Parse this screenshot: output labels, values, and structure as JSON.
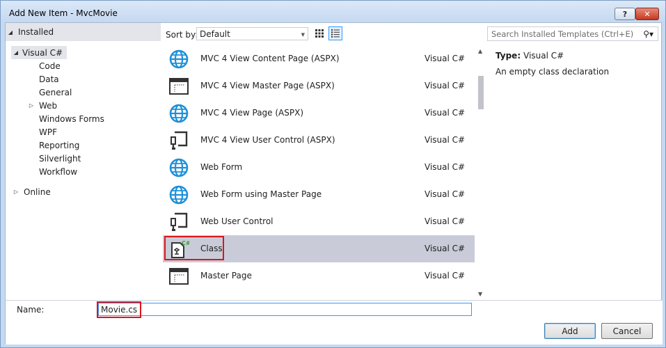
{
  "window": {
    "title": "Add New Item - MvcMovie",
    "help_label": "?",
    "close_label": "✕"
  },
  "tree": {
    "header": "Installed",
    "nodes": [
      {
        "label": "Visual C#",
        "expander": "◢"
      },
      {
        "label": "Code"
      },
      {
        "label": "Data"
      },
      {
        "label": "General"
      },
      {
        "label": "Web",
        "expander": "▷"
      },
      {
        "label": "Windows Forms"
      },
      {
        "label": "WPF"
      },
      {
        "label": "Reporting"
      },
      {
        "label": "Silverlight"
      },
      {
        "label": "Workflow"
      },
      {
        "label": "Online",
        "expander": "▷"
      }
    ]
  },
  "sort": {
    "label": "Sort by:",
    "value": "Default"
  },
  "items": [
    {
      "name": "MVC 4 View Content Page (ASPX)",
      "lang": "Visual C#",
      "icon": "globe-icon"
    },
    {
      "name": "MVC 4 View Master Page (ASPX)",
      "lang": "Visual C#",
      "icon": "master-page-icon"
    },
    {
      "name": "MVC 4 View Page (ASPX)",
      "lang": "Visual C#",
      "icon": "globe-icon"
    },
    {
      "name": "MVC 4 View User Control (ASPX)",
      "lang": "Visual C#",
      "icon": "user-control-icon"
    },
    {
      "name": "Web Form",
      "lang": "Visual C#",
      "icon": "globe-icon"
    },
    {
      "name": "Web Form using Master Page",
      "lang": "Visual C#",
      "icon": "globe-icon"
    },
    {
      "name": "Web User Control",
      "lang": "Visual C#",
      "icon": "user-control-icon"
    },
    {
      "name": "Class",
      "lang": "Visual C#",
      "icon": "csharp-class-icon",
      "selected": true
    },
    {
      "name": "Master Page",
      "lang": "Visual C#",
      "icon": "master-page-icon"
    }
  ],
  "search": {
    "placeholder": "Search Installed Templates (Ctrl+E)"
  },
  "details": {
    "type_label": "Type:",
    "type_value": "Visual C#",
    "description": "An empty class declaration"
  },
  "bottom": {
    "name_label": "Name:",
    "name_value": "Movie.cs",
    "add_label": "Add",
    "cancel_label": "Cancel"
  },
  "colors": {
    "accent": "#3399ff",
    "highlight": "#d9161b",
    "selected_row": "#c9ccd8",
    "globe": "#1e90d8"
  }
}
